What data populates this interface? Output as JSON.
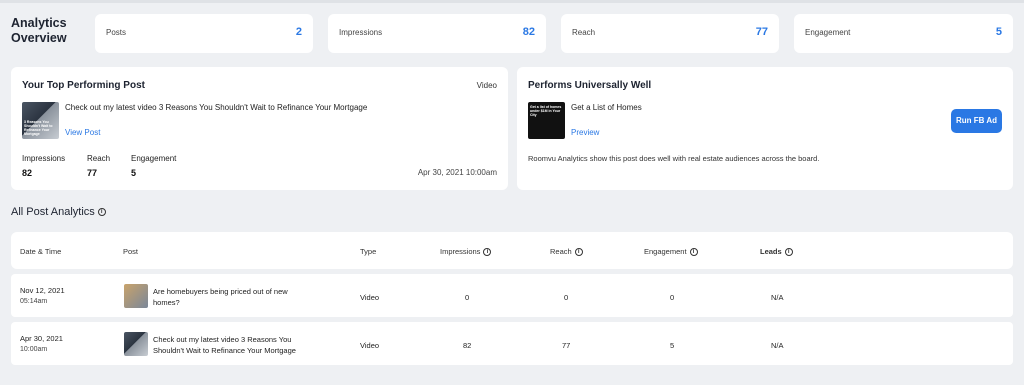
{
  "overview": {
    "title": "Analytics Overview",
    "stats": [
      {
        "label": "Posts",
        "value": "2"
      },
      {
        "label": "Impressions",
        "value": "82"
      },
      {
        "label": "Reach",
        "value": "77"
      },
      {
        "label": "Engagement",
        "value": "5"
      }
    ]
  },
  "top_post": {
    "title": "Your Top Performing Post",
    "type": "Video",
    "thumb_text": "3 Reasons You Shouldn't Wait to Refinance Your Mortgage",
    "text": "Check out my latest video 3 Reasons You Shouldn't Wait to Refinance Your Mortgage",
    "link": "View Post",
    "metrics": [
      {
        "label": "Impressions",
        "value": "82"
      },
      {
        "label": "Reach",
        "value": "77"
      },
      {
        "label": "Engagement",
        "value": "5"
      }
    ],
    "date": "Apr 30, 2021 10:00am"
  },
  "universal": {
    "title": "Performs Universally Well",
    "thumb_text": "Get a list of homes under $1M in Your City",
    "text": "Get a List of Homes",
    "link": "Preview",
    "button": "Run FB Ad",
    "description": "Roomvu Analytics show this post does well with real estate audiences across the board."
  },
  "table": {
    "title": "All Post Analytics",
    "info_glyph": "i",
    "headers": {
      "date": "Date & Time",
      "post": "Post",
      "type": "Type",
      "impressions": "Impressions",
      "reach": "Reach",
      "engagement": "Engagement",
      "leads": "Leads"
    },
    "rows": [
      {
        "date": "Nov 12, 2021",
        "time": "05:14am",
        "post_line1": "Are homebuyers being priced out of new",
        "post_line2": "homes?",
        "type": "Video",
        "impressions": "0",
        "reach": "0",
        "engagement": "0",
        "leads": "N/A"
      },
      {
        "date": "Apr 30, 2021",
        "time": "10:00am",
        "post_line1": "Check out my latest video 3 Reasons You",
        "post_line2": "Shouldn't Wait to Refinance Your Mortgage",
        "type": "Video",
        "impressions": "82",
        "reach": "77",
        "engagement": "5",
        "leads": "N/A"
      }
    ]
  },
  "colors": {
    "accent": "#2a78e4",
    "background": "#eef0f3",
    "card": "#ffffff"
  }
}
